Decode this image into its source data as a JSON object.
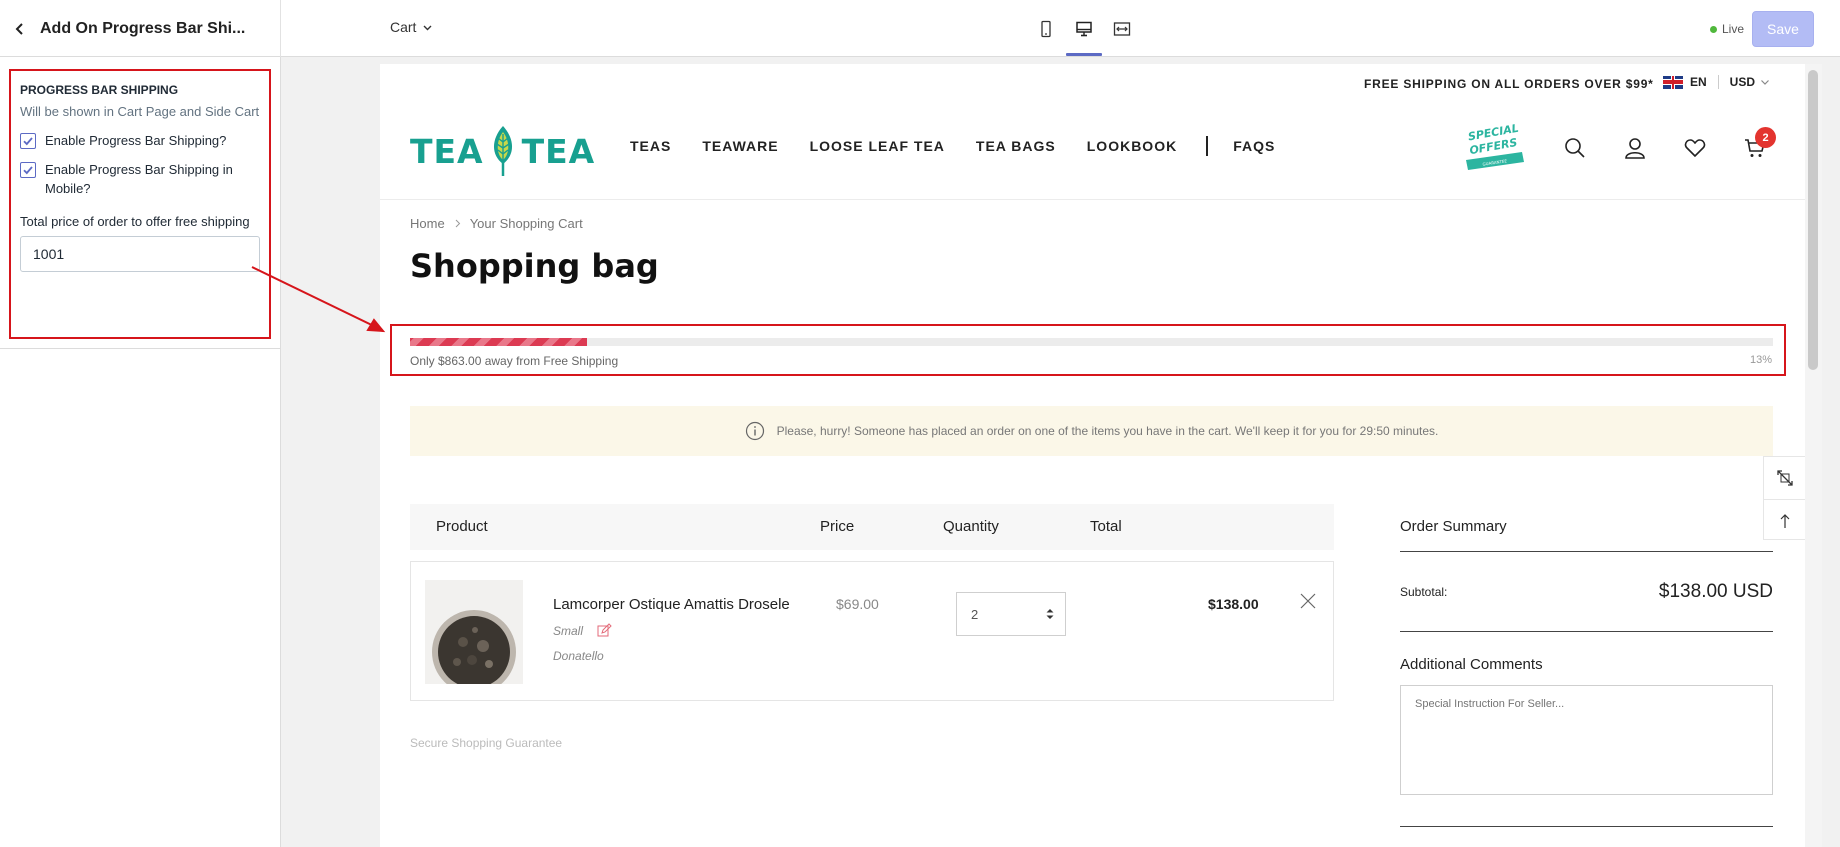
{
  "editor": {
    "app_title": "Add On Progress Bar Shi...",
    "page_selector": "Cart",
    "status": "Live",
    "save_label": "Save",
    "accent_color": "#5c6ac4"
  },
  "settings": {
    "heading": "PROGRESS BAR SHIPPING",
    "info": "Will be shown in Cart Page and Side Cart",
    "enable_label": "Enable Progress Bar Shipping?",
    "enable_checked": true,
    "mobile_label": "Enable Progress Bar Shipping in Mobile?",
    "mobile_checked": true,
    "threshold_label": "Total price of order to offer free shipping",
    "threshold_value": "1001"
  },
  "store": {
    "announcement": "FREE SHIPPING ON ALL ORDERS OVER $99*",
    "language": "EN",
    "currency": "USD",
    "logo_left": "TEA",
    "logo_right": "TEA",
    "brand_color": "#18a090",
    "nav": [
      "TEAS",
      "TEAWARE",
      "LOOSE LEAF TEA",
      "TEA BAGS",
      "LOOKBOOK",
      "FAQS"
    ],
    "special_offers_line1": "SPECIAL",
    "special_offers_line2": "OFFERS",
    "special_offers_ribbon": "GUARANTEE",
    "cart_count": "2"
  },
  "cart_page": {
    "breadcrumb_home": "Home",
    "breadcrumb_current": "Your Shopping Cart",
    "title": "Shopping bag",
    "progress_message": "Only $863.00 away from Free Shipping",
    "progress_percent_label": "13%",
    "progress_fraction": 0.13,
    "progress_color": "#dc3a52",
    "hurry_message": "Please, hurry! Someone has placed an order on one of the items you have in the cart. We'll keep it for you for 29:50 minutes.",
    "columns": {
      "product": "Product",
      "price": "Price",
      "quantity": "Quantity",
      "total": "Total"
    },
    "item": {
      "name": "Lamcorper Ostique Amattis Drosele",
      "variant": "Small",
      "vendor": "Donatello",
      "price": "$69.00",
      "quantity": "2",
      "total": "$138.00"
    },
    "secure_label": "Secure Shopping Guarantee",
    "summary": {
      "title": "Order Summary",
      "subtotal_label": "Subtotal:",
      "subtotal_value": "$138.00 USD",
      "comments_title": "Additional Comments",
      "comments_placeholder": "Special Instruction For Seller..."
    }
  },
  "annotation_color": "#d6151b"
}
